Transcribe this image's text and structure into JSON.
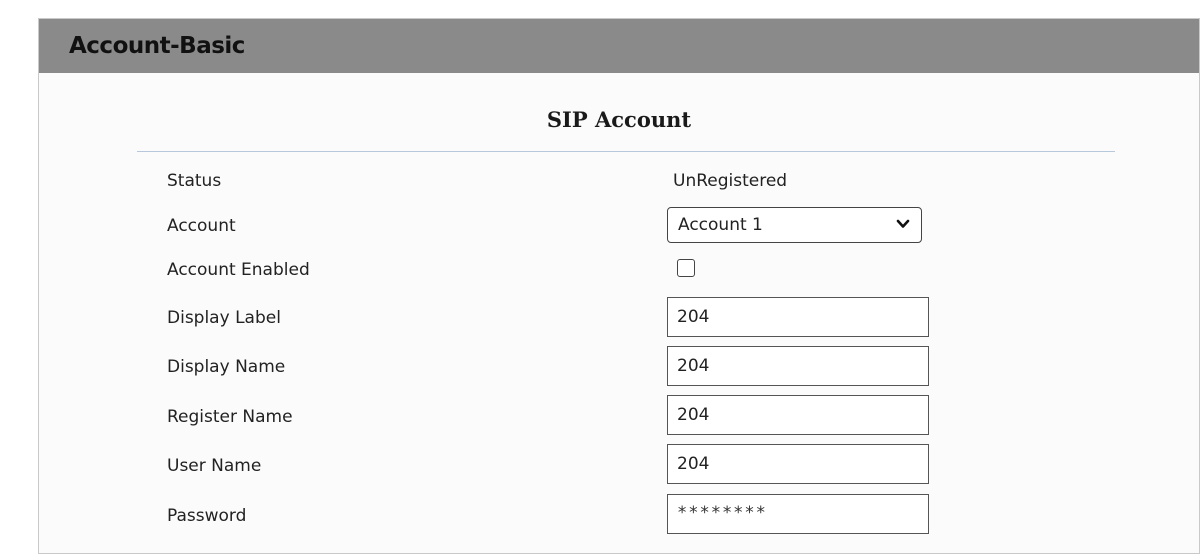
{
  "panel": {
    "title": "Account-Basic"
  },
  "section": {
    "title": "SIP Account"
  },
  "fields": {
    "status": {
      "label": "Status",
      "value": "UnRegistered"
    },
    "account": {
      "label": "Account",
      "selected": "Account 1"
    },
    "account_enabled": {
      "label": "Account Enabled",
      "checked": false
    },
    "display_label": {
      "label": "Display Label",
      "value": "204"
    },
    "display_name": {
      "label": "Display Name",
      "value": "204"
    },
    "register_name": {
      "label": "Register Name",
      "value": "204"
    },
    "user_name": {
      "label": "User Name",
      "value": "204"
    },
    "password": {
      "label": "Password",
      "value": "********"
    }
  },
  "icons": {
    "account_select_arrow": "chevron-down-icon"
  },
  "colors": {
    "header_bg": "#8a8a8a",
    "rule": "#b8c8dc"
  }
}
